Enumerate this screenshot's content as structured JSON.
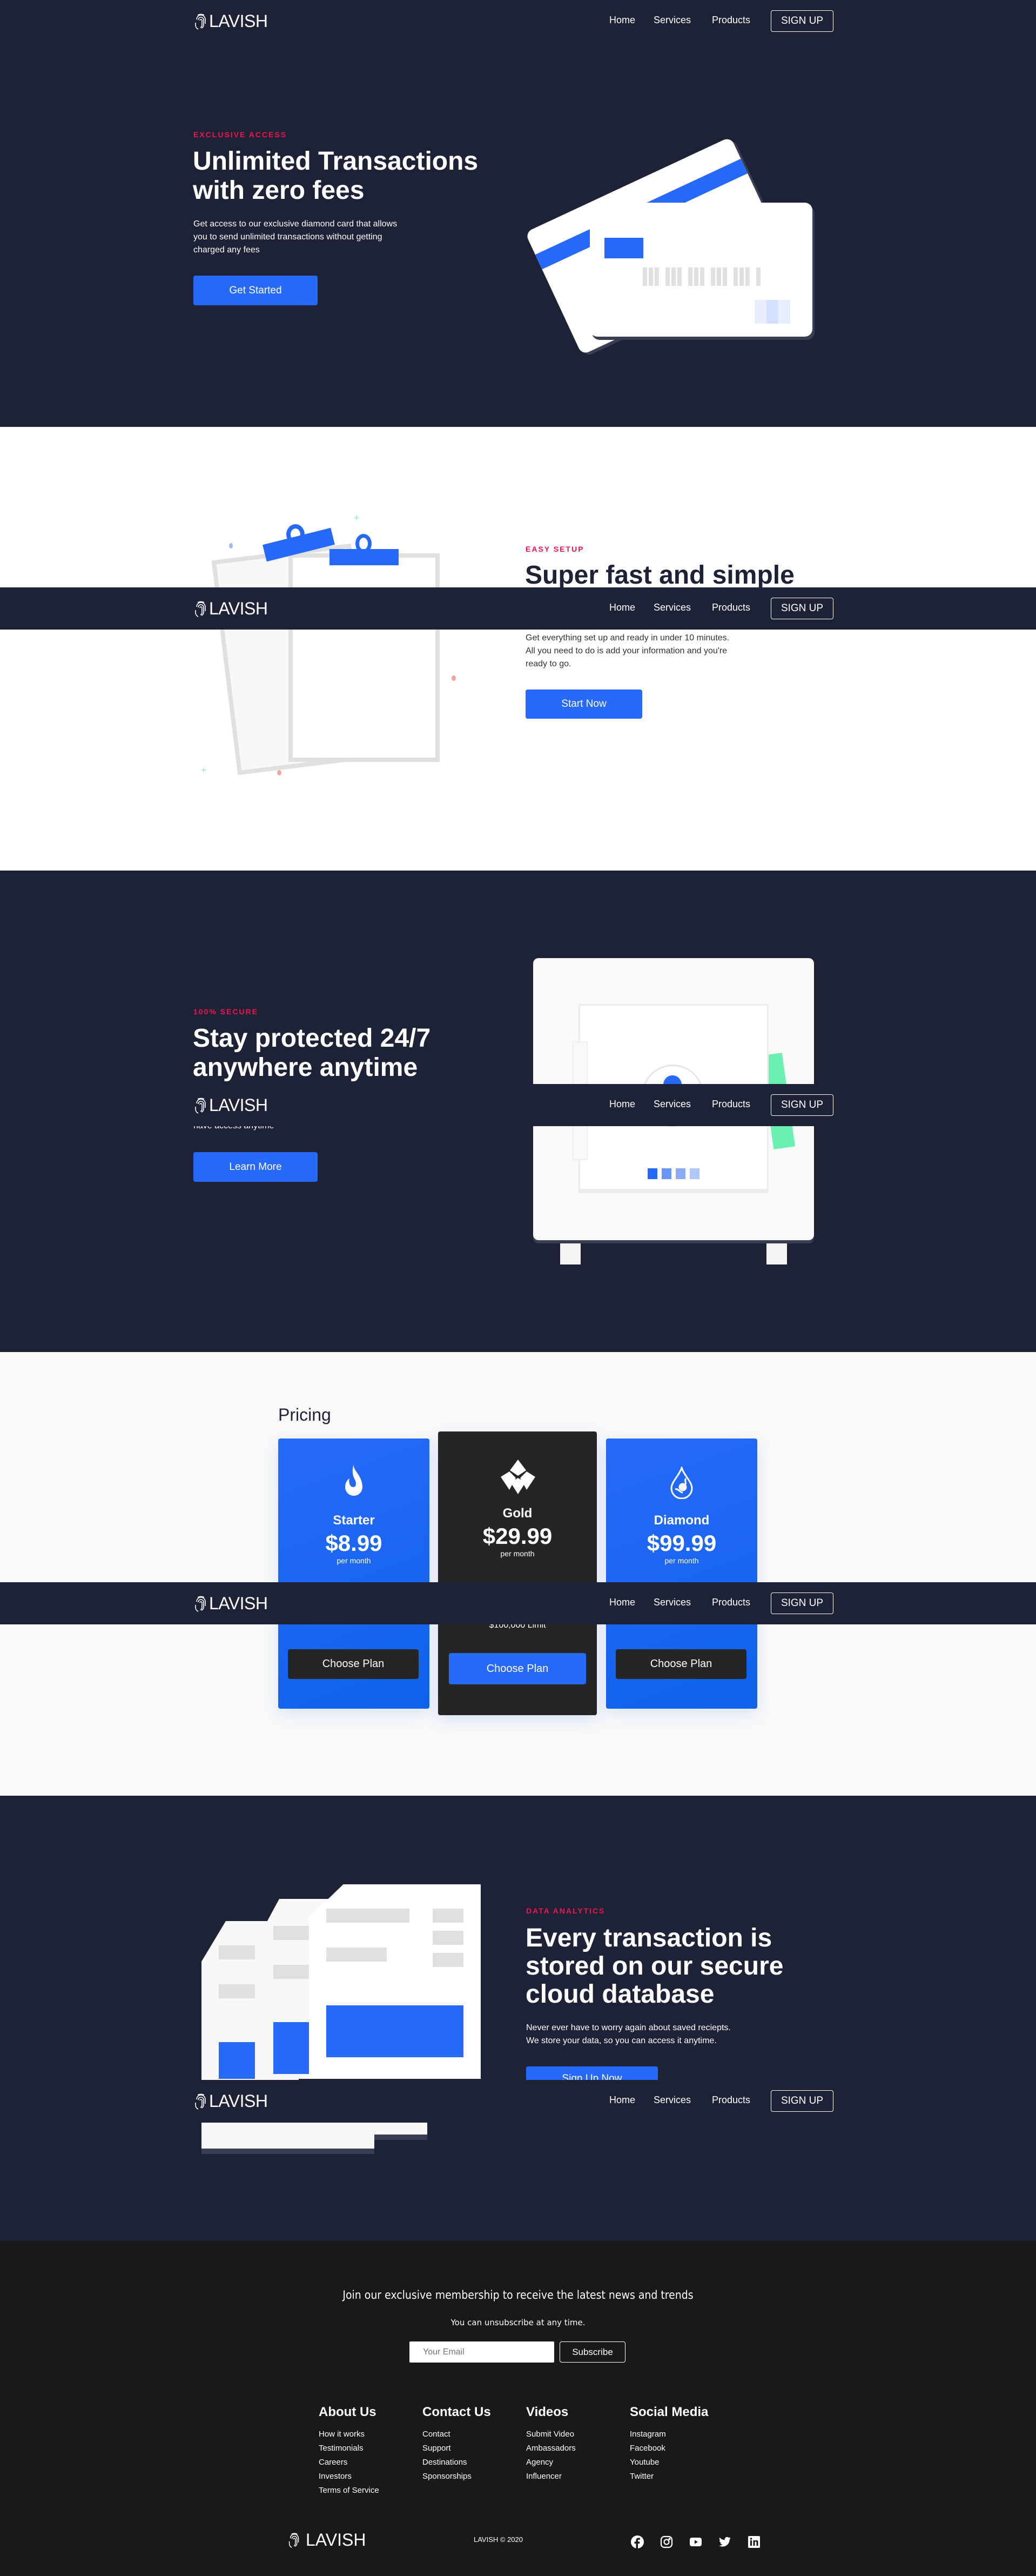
{
  "nav": {
    "logo": "LAVISH",
    "links": [
      "Home",
      "Services",
      "Products"
    ],
    "signup": "SIGN UP"
  },
  "hero": {
    "eyebrow": "EXCLUSIVE ACCESS",
    "title_1": "Unlimited Transactions",
    "title_2": "with zero fees",
    "desc_1": "Get access to our exclusive diamond card that allows",
    "desc_2": "you to send unlimited transactions without getting",
    "desc_3": "charged any fees",
    "button": "Get Started"
  },
  "setup": {
    "eyebrow": "EASY SETUP",
    "title": "Super fast and simple",
    "desc_1": "Get everything set up and ready in under 10 minutes.",
    "desc_2": "All you need to do is add your information and you're",
    "desc_3": "ready to go.",
    "button": "Start Now"
  },
  "secure": {
    "eyebrow": "100% SECURE",
    "title_1": "Stay protected 24/7",
    "title_2": "anywhere anytime",
    "desc_tail": "have access anytime",
    "button": "Learn More"
  },
  "pricing": {
    "title": "Pricing",
    "plans": [
      {
        "name": "Starter",
        "price": "$8.99",
        "per": "per month",
        "button": "Choose Plan",
        "icon": "fire-icon"
      },
      {
        "name": "Gold",
        "price": "$29.99",
        "per": "per month",
        "feature": "$100,000 Limit",
        "button": "Choose Plan",
        "icon": "diamond-grid-icon"
      },
      {
        "name": "Diamond",
        "price": "$99.99",
        "per": "per month",
        "button": "Choose Plan",
        "icon": "water-drop-icon"
      }
    ]
  },
  "analytics": {
    "eyebrow": "DATA ANALYTICS",
    "title_1": "Every transaction is",
    "title_2": "stored on our secure",
    "title_3": "cloud database",
    "desc_1": "Never ever have to worry again about saved reciepts.",
    "desc_2": "We store your data, so you can access it anytime.",
    "button": "Sign Up Now"
  },
  "footer": {
    "heading": "Join our exclusive membership to receive the latest news and trends",
    "sub": "You can unsubscribe at any time.",
    "email_placeholder": "Your Email",
    "subscribe": "Subscribe",
    "columns": [
      {
        "title": "About Us",
        "links": [
          "How it works",
          "Testimonials",
          "Careers",
          "Investors",
          "Terms of Service"
        ]
      },
      {
        "title": "Contact Us",
        "links": [
          "Contact",
          "Support",
          "Destinations",
          "Sponsorships"
        ]
      },
      {
        "title": "Videos",
        "links": [
          "Submit Video",
          "Ambassadors",
          "Agency",
          "Influencer"
        ]
      },
      {
        "title": "Social Media",
        "links": [
          "Instagram",
          "Facebook",
          "Youtube",
          "Twitter"
        ]
      }
    ],
    "logo": "LAVISH",
    "copyright": "LAVISH © 2020",
    "social_icons": [
      "facebook-icon",
      "instagram-icon",
      "youtube-icon",
      "twitter-icon",
      "linkedin-icon"
    ]
  },
  "colors": {
    "dark": "#1e2237",
    "accent": "#276afb",
    "eyebrow": "#ef1450",
    "footer": "#1a1919"
  }
}
